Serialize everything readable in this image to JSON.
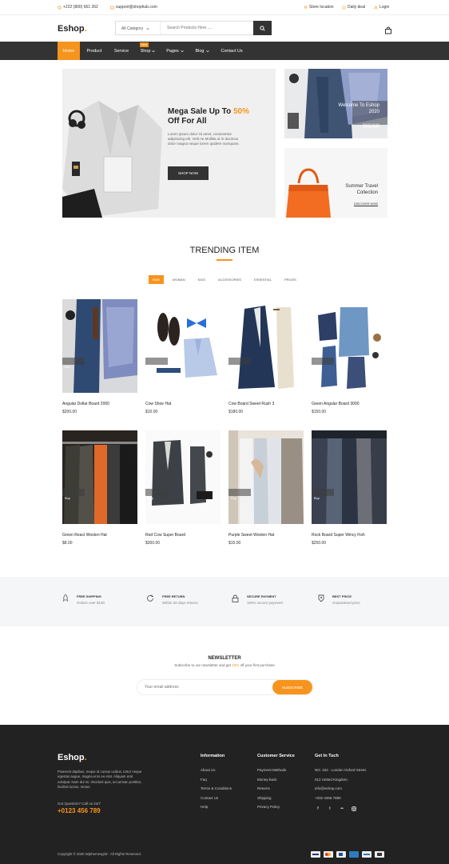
{
  "topbar": {
    "phone": "+222 (800) 661 262",
    "email": "support@shophub.com",
    "store_location": "Store location",
    "daily_deal": "Daily deal",
    "login": "Login"
  },
  "header": {
    "logo": "Eshop",
    "logo_dot": ".",
    "category_select": "All Category",
    "search_placeholder": "Search Products Here.....",
    "search_icon": "search-icon",
    "cart_icon": "shopping-bag-icon"
  },
  "nav": {
    "items": [
      {
        "label": "Home",
        "active": true
      },
      {
        "label": "Product"
      },
      {
        "label": "Service"
      },
      {
        "label": "Shop",
        "badge": "New"
      },
      {
        "label": "Pages"
      },
      {
        "label": "Blog"
      },
      {
        "label": "Contact Us"
      }
    ]
  },
  "hero": {
    "title_line1": "Mega Sale Up To ",
    "title_accent": "50%",
    "title_line2": "Off For All",
    "text_line1": "Lorem ipsum dolor sit amet, consectetur",
    "text_line2": "adipisicing elit. Velit ne Mollitia ut in ducimus",
    "text_line3": "dolor magna neque lorem quidem numquam.",
    "button": "SHOP NOW"
  },
  "promos": [
    {
      "title_line1": "Welcome To Eshop",
      "title_line2": "2020",
      "link": "SHOP NOW"
    },
    {
      "title_line1": "Summer Travel",
      "title_line2": "Collection",
      "link": "DISCOVER NOW"
    }
  ],
  "trending": {
    "title": "TRENDING ITEM",
    "filters": [
      "Man",
      "Woman",
      "Kids",
      "Accessories",
      "Essential",
      "Prices"
    ],
    "products": [
      {
        "name": "Angular Dollar Board 2000",
        "price": "$200.00",
        "art": "shirt-jeans"
      },
      {
        "name": "Cow Shoe Hat",
        "price": "$10.00",
        "art": "shoes-tie"
      },
      {
        "name": "Cow Board Sweet Rush 3",
        "price": "$180.00",
        "art": "blazer-beige"
      },
      {
        "name": "Green Angular Board 3000",
        "price": "$150.00",
        "art": "denim-set"
      },
      {
        "name": "Green React Woolen Hat",
        "price": "$8.00",
        "art": "rack-coats"
      },
      {
        "name": "Red Cow Super Board",
        "price": "$300.00",
        "art": "grey-suit"
      },
      {
        "name": "Purple Sweet Woolen Hat",
        "price": "$15.00",
        "art": "wardrobe"
      },
      {
        "name": "Rock Board Super Wincy Fish",
        "price": "$250.00",
        "art": "suits-rail"
      }
    ],
    "quick_shop": "Buy"
  },
  "services": [
    {
      "icon": "rocket-icon",
      "title": "Free shipping",
      "desc": "Orders over $100"
    },
    {
      "icon": "refresh-icon",
      "title": "Free Return",
      "desc": "Within 30 days returns"
    },
    {
      "icon": "lock-icon",
      "title": "Secure Payment",
      "desc": "100% secure payment"
    },
    {
      "icon": "tag-icon",
      "title": "Best Price",
      "desc": "Guaranteed price"
    }
  ],
  "newsletter": {
    "title": "NEWSLETTER",
    "subtitle_pre": "Subscribe to our newsletter and get ",
    "subtitle_accent": "10%",
    "subtitle_post": " off your first purchase",
    "placeholder": "Your email address",
    "button": "SUBSCRIBE"
  },
  "footer": {
    "logo": "Eshop",
    "about_line1": "Praesent dapibus, neque id cursus ucibus, tortor neque",
    "about_line2": "egestas augue, magna eros eu erat. Aliquam erat",
    "about_line3": "volutpat. Nam dui mi, tincidunt quis, accumsan porttitor,",
    "about_line4": "facilisis luctus, metus.",
    "question": "Got Question? Call us 24/7",
    "phone": "+0123 456 789",
    "information": {
      "heading": "Information",
      "links": [
        "About Us",
        "Faq",
        "Terms & Conditions",
        "Contact Us",
        "Help"
      ]
    },
    "customer_service": {
      "heading": "Customer Service",
      "links": [
        "Payment Methods",
        "Money-back",
        "Returns",
        "Shipping",
        "Privacy Policy"
      ]
    },
    "contact": {
      "heading": "Get In Tuch",
      "lines": [
        "NO. 342 - London Oxford Street.",
        "012 United Kingdom.",
        "info@eshop.com",
        "+032 3456 7890"
      ]
    },
    "social_icons": [
      "facebook-icon",
      "twitter-icon",
      "flickr-icon",
      "instagram-icon"
    ],
    "copyright": "Copyright © 2020 Wpthemesgrid  -  All Rights Reserved.",
    "payment_icons": [
      "visa-icon",
      "mastercard-icon",
      "paypal-icon",
      "amex-icon",
      "card-icon",
      "applepay-icon"
    ]
  },
  "colors": {
    "accent": "#f7941d",
    "dark": "#333333",
    "footer": "#222222"
  }
}
